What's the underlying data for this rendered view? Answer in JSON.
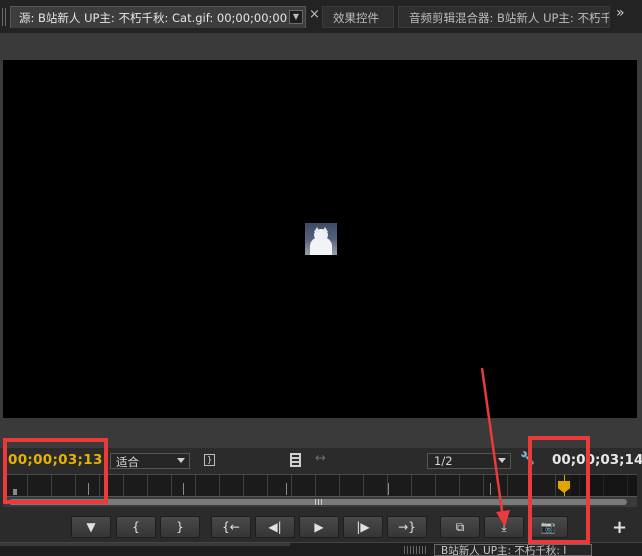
{
  "tabs": {
    "source_label": "源: B站新人 UP主: 不朽千秋: Cat.gif: 00;00;00;00",
    "effects_label": "效果控件",
    "mixer_label": "音频剪辑混合器: B站新人 UP主: 不朽千秋"
  },
  "viewer": {
    "timecode_current": "00;00;03;13",
    "fit_option": "适合",
    "resolution_option": "1/2",
    "timecode_duration": "00;00;03;14"
  },
  "transport": {
    "buttons": [
      {
        "name": "add-marker",
        "glyph": "▼"
      },
      {
        "name": "mark-in",
        "glyph": "{"
      },
      {
        "name": "mark-out",
        "glyph": "}"
      },
      {
        "name": "go-to-in",
        "glyph": "{←"
      },
      {
        "name": "step-back",
        "glyph": "◀|"
      },
      {
        "name": "play",
        "glyph": "▶"
      },
      {
        "name": "step-forward",
        "glyph": "|▶"
      },
      {
        "name": "go-to-out",
        "glyph": "→}"
      },
      {
        "name": "insert",
        "glyph": "⧉"
      },
      {
        "name": "overwrite",
        "glyph": "⤓"
      },
      {
        "name": "export-frame",
        "glyph": "📷"
      }
    ],
    "add_glyph": "+"
  },
  "bottom": {
    "tab_label": "B站新人 UP主: 不朽千秋: Ⅰ"
  },
  "colors": {
    "timecode_accent": "#e8b300",
    "annotation_red": "#ea3a3a"
  }
}
